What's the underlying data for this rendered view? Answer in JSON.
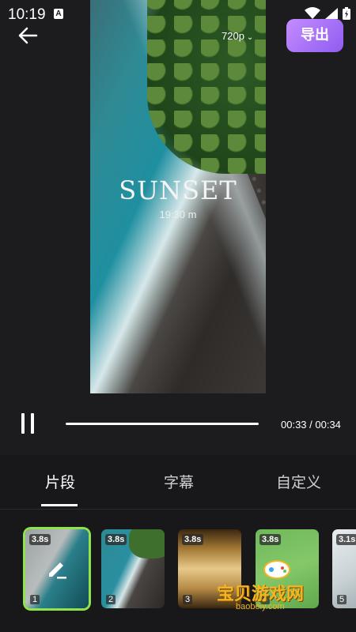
{
  "status_bar": {
    "time": "10:19",
    "notification_label": "A"
  },
  "top_bar": {
    "export_label": "导出"
  },
  "preview": {
    "resolution": "720p",
    "overlay_title": "SUNSET",
    "overlay_subtitle": "19:30 m"
  },
  "playback": {
    "time_display": "00:33 / 00:34",
    "progress_fraction": 1.0
  },
  "tabs": [
    {
      "label": "片段",
      "active": true
    },
    {
      "label": "字幕",
      "active": false
    },
    {
      "label": "自定义",
      "active": false
    }
  ],
  "clips": [
    {
      "duration": "3.8s",
      "index": "1",
      "selected": true
    },
    {
      "duration": "3.8s",
      "index": "2",
      "selected": false
    },
    {
      "duration": "3.8s",
      "index": "3",
      "selected": false
    },
    {
      "duration": "3.8s",
      "index": "4",
      "selected": false
    },
    {
      "duration": "3.1s",
      "index": "5",
      "selected": false
    }
  ],
  "watermark": {
    "title": "宝贝游戏网",
    "url": "baobeiy.com"
  },
  "colors": {
    "accent_gradient_start": "#c58cff",
    "accent_gradient_end": "#8f5cf0",
    "selected_clip_border": "#8ee44a",
    "background": "#1c1c1e"
  }
}
